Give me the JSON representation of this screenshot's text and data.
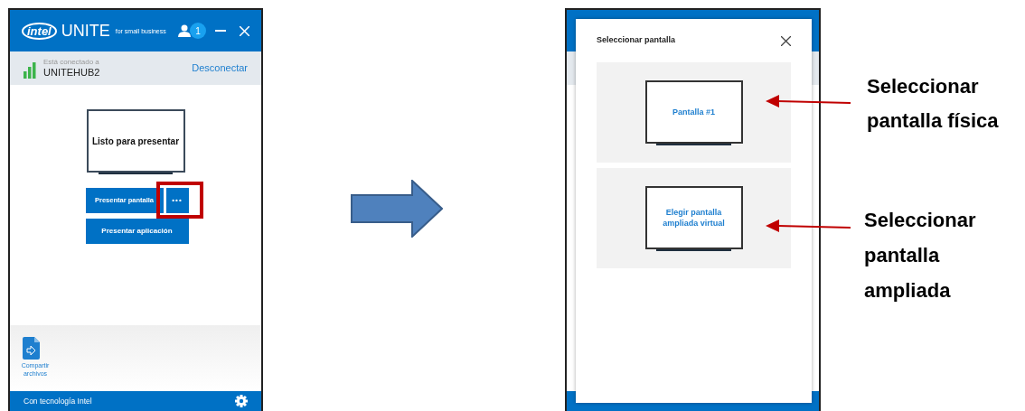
{
  "left_window": {
    "logo": "intel",
    "app_name": "UNITE",
    "tagline": "for small business",
    "user_count": "1",
    "connection": {
      "label": "Está conectado a",
      "hub": "UNITEHUB2",
      "action": "Desconectar"
    },
    "preview": "Listo para presentar",
    "present_buttons": [
      {
        "label": "Presentar pantalla",
        "callout": false
      },
      {
        "label": "•••",
        "callout": true
      },
      {
        "label": "Presentar aplicación",
        "callout": false
      }
    ],
    "share": {
      "label": "Compartir archivos"
    },
    "footer": "Con tecnología Intel"
  },
  "right_window": {
    "dialog": {
      "title": "Seleccionar pantalla",
      "options": [
        {
          "label": "Pantalla #1"
        },
        {
          "label": "Elegir pantalla ampliada virtual"
        }
      ]
    }
  },
  "annotations": [
    {
      "text": "Seleccionar pantalla física"
    },
    {
      "text": "Seleccionar pantalla ampliada"
    }
  ]
}
